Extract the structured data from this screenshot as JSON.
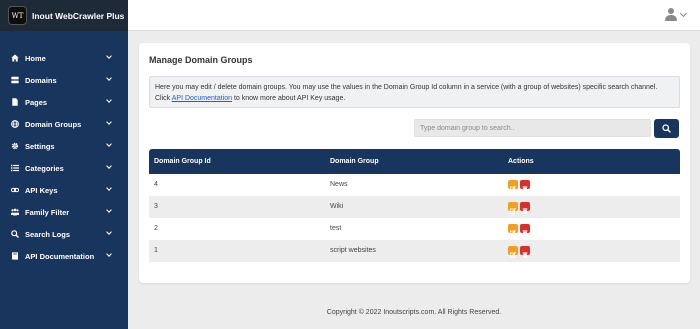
{
  "app": {
    "logo_badge": "WT",
    "title": "Inout WebCrawler Plus"
  },
  "header": {
    "user_icon": "user-icon"
  },
  "sidebar": {
    "items": [
      {
        "label": "Home",
        "icon": "home-icon"
      },
      {
        "label": "Domains",
        "icon": "server-icon"
      },
      {
        "label": "Pages",
        "icon": "file-icon"
      },
      {
        "label": "Domain Groups",
        "icon": "globe-icon"
      },
      {
        "label": "Settings",
        "icon": "gear-icon"
      },
      {
        "label": "Categories",
        "icon": "list-icon"
      },
      {
        "label": "API Keys",
        "icon": "link-icon"
      },
      {
        "label": "Family Filter",
        "icon": "users-icon"
      },
      {
        "label": "Search Logs",
        "icon": "search-icon"
      },
      {
        "label": "API Documentation",
        "icon": "book-icon"
      }
    ]
  },
  "main": {
    "title": "Manage Domain Groups",
    "info": {
      "text_before": "Here you may edit / delete domain groups. You may use the values in the Domain Group Id column in a service (with a group of websites) specific search channel. Click ",
      "link": "API Documentation",
      "text_after": " to know more about API Key usage."
    },
    "search": {
      "placeholder": "Type domain group to search..",
      "value": ""
    },
    "table": {
      "headers": [
        "Domain Group Id",
        "Domain Group",
        "Actions"
      ],
      "rows": [
        {
          "id": "4",
          "name": "News"
        },
        {
          "id": "3",
          "name": "Wiki"
        },
        {
          "id": "2",
          "name": "test"
        },
        {
          "id": "1",
          "name": "script websites"
        }
      ]
    }
  },
  "footer": {
    "text": "Copyright © 2022 Inoutscripts.com. All Rights Reserved."
  },
  "colors": {
    "sidebar": "#18355d",
    "edit": "#f0a020",
    "delete": "#d9302c"
  }
}
